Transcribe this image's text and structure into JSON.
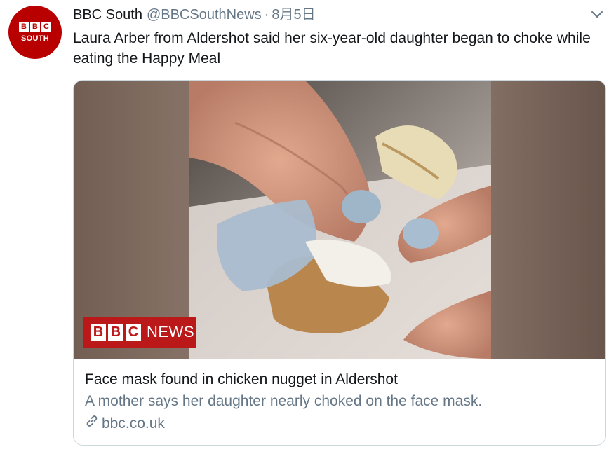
{
  "tweet": {
    "avatar": {
      "line1": [
        "B",
        "B",
        "C"
      ],
      "line2": "SOUTH"
    },
    "display_name": "BBC South",
    "handle": "@BBCSouthNews",
    "separator": "·",
    "date": "8月5日",
    "text": "Laura Arber from Aldershot said her six-year-old daughter began to choke while eating the Happy Meal",
    "more_icon": "chevron-down-icon"
  },
  "card": {
    "media_logo": {
      "blocks": [
        "B",
        "B",
        "C"
      ],
      "word": "NEWS"
    },
    "title": "Face mask found in chicken nugget in Aldershot",
    "description": "A mother says her daughter nearly choked on the face mask.",
    "link_icon": "link-icon",
    "domain": "bbc.co.uk"
  },
  "colors": {
    "bbc_red": "#bb1919",
    "avatar_red": "#b80000",
    "text_primary": "#14171a",
    "text_secondary": "#657786",
    "border": "#ccd6dd"
  }
}
